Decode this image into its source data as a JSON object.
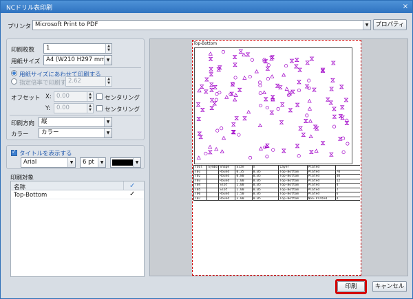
{
  "window": {
    "title": "NCドリル表印刷",
    "close_glyph": "×"
  },
  "printer": {
    "label": "プリンタ",
    "value": "Microsoft Print to PDF",
    "properties_label": "プロパティ"
  },
  "settings": {
    "copies_label": "印刷枚数",
    "copies_value": "1",
    "paper_label": "用紙サイズ",
    "paper_value": "A4 (W210 H297 mm)",
    "fit_label": "用紙サイズにあわせて印刷する",
    "scale_label": "指定倍率で印刷する",
    "scale_value": "2.62",
    "offset_label": "オフセット",
    "x_label": "X:",
    "x_value": "0.00",
    "y_label": "Y:",
    "y_value": "0.00",
    "center_label": "センタリング",
    "orientation_label": "印刷方向",
    "orientation_value": "縦",
    "color_label": "カラー",
    "color_value": "カラー"
  },
  "title_options": {
    "show_label": "タイトルを表示する",
    "font_value": "Arial",
    "size_value": "6 pt",
    "color_hex": "#000000"
  },
  "targets": {
    "label": "印刷対象",
    "col_name": "名称",
    "header_check": "✓",
    "rows": [
      {
        "name": "Top-Bottom",
        "check": "✓"
      }
    ]
  },
  "preview": {
    "heading": "Top-Bottom",
    "table_rows": [
      [
        "Tool",
        "Symbol",
        "Shape",
        "Size",
        "X",
        "Layer",
        "Plated",
        ""
      ],
      [
        "T01",
        "",
        "Round",
        "0.35",
        "0.05",
        "Top-Bottom",
        "Plated",
        "70"
      ],
      [
        "T02",
        "",
        "Round",
        "0.80",
        "0.05",
        "Top-Bottom",
        "Plated",
        "40"
      ],
      [
        "T03",
        "",
        "Round",
        "1.00",
        "0.05",
        "Top-Bottom",
        "Plated",
        "12"
      ],
      [
        "T04",
        "",
        "Slot",
        "1.00",
        "0.05",
        "Top-Bottom",
        "Plated",
        "4"
      ],
      [
        "T05",
        "",
        "Slot",
        "1.00",
        "0.05",
        "Top-Bottom",
        "Plated",
        "2"
      ],
      [
        "T06",
        "",
        "Round",
        "1.50",
        "0.05",
        "Top-Bottom",
        "Plated",
        "6"
      ],
      [
        "T07",
        "",
        "Round",
        "3.00",
        "0.05",
        "Top-Bottom",
        "Non-Plated",
        "4"
      ]
    ]
  },
  "buttons": {
    "print": "印刷",
    "cancel": "キャンセル"
  },
  "colors": {
    "accent": "#3d7fd0",
    "drill_mark": "#a000c8",
    "highlight": "#d30000"
  }
}
